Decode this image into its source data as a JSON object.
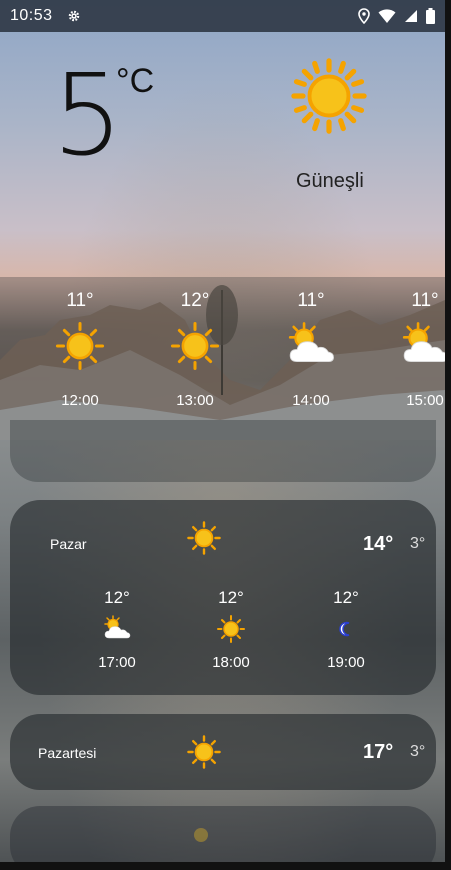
{
  "status_bar": {
    "time": "10:53",
    "icons": [
      "gear-icon",
      "location-icon",
      "wifi-icon",
      "signal-icon",
      "battery-icon"
    ]
  },
  "current": {
    "temperature": "5",
    "unit": "°C",
    "condition": "Güneşli",
    "icon": "sun-icon"
  },
  "hourly": [
    {
      "temp": "11°",
      "time": "12:00",
      "icon": "sun-icon"
    },
    {
      "temp": "12°",
      "time": "13:00",
      "icon": "sun-icon"
    },
    {
      "temp": "11°",
      "time": "14:00",
      "icon": "partly-cloudy-icon"
    },
    {
      "temp": "11°",
      "time": "15:00",
      "icon": "partly-cloudy-icon"
    }
  ],
  "days": [
    {
      "name": "Pazar",
      "icon": "sun-icon",
      "high": "14°",
      "low": "3°",
      "hours": [
        {
          "temp": "12°",
          "time": "17:00",
          "icon": "partly-cloudy-icon"
        },
        {
          "temp": "12°",
          "time": "18:00",
          "icon": "sun-icon"
        },
        {
          "temp": "12°",
          "time": "19:00",
          "icon": "moon-icon"
        }
      ]
    },
    {
      "name": "Pazartesi",
      "icon": "sun-icon",
      "high": "17°",
      "low": "3°"
    }
  ],
  "colors": {
    "sun": "#f7c21a",
    "sun_rays": "#f5a300",
    "cloud": "#ffffff",
    "moon": "#2b3fd1"
  }
}
